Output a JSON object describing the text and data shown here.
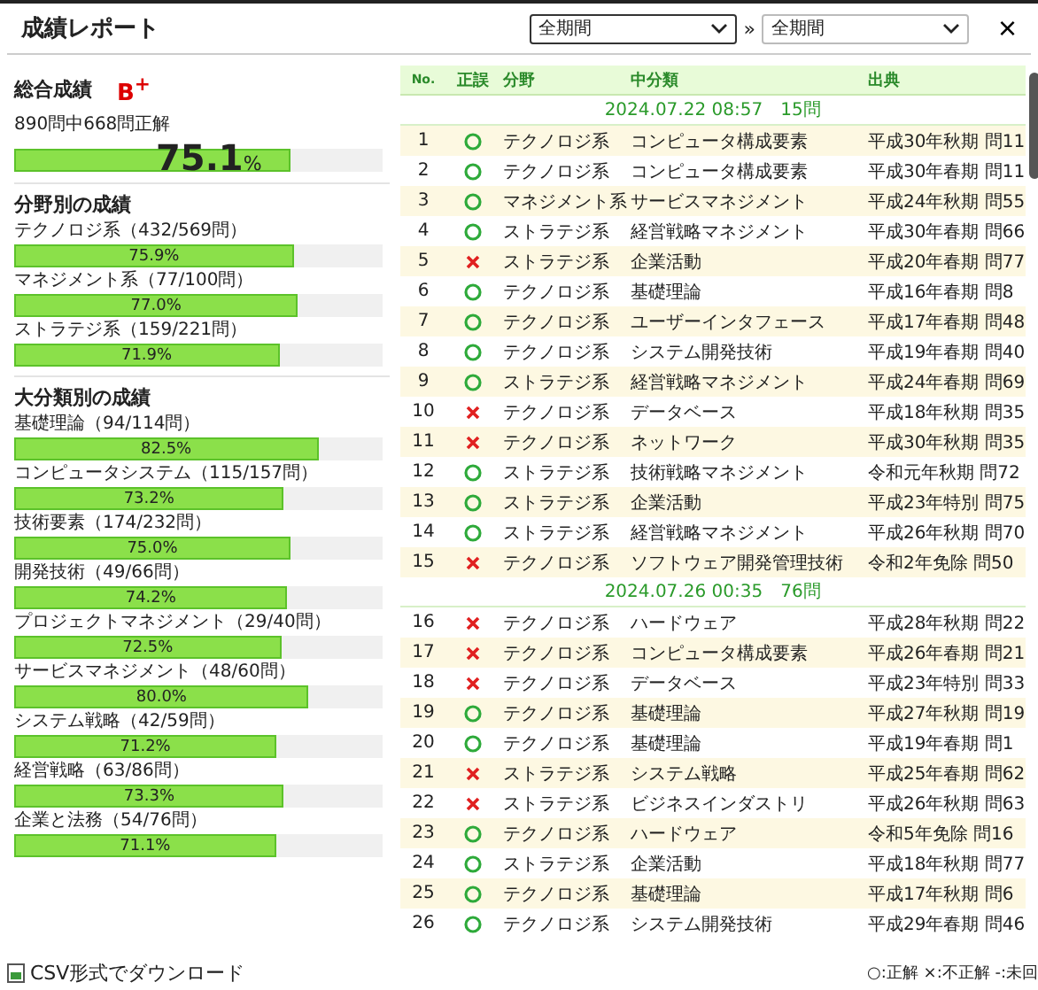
{
  "window": {
    "title": "成績レポート",
    "period_from": "全期間",
    "separator": "»",
    "period_to": "全期間",
    "close": "×"
  },
  "overall": {
    "heading": "総合成績",
    "grade": "B$^{+}$",
    "summary": "890問中668問正解",
    "percent": "75.1",
    "unit": "%",
    "level": 0.751
  },
  "sections": [
    {
      "heading": "分野別の成績",
      "items": [
        {
          "label": "テクノロジ系（432/569問）",
          "reading": "75.9%",
          "level": 0.759
        },
        {
          "label": "マネジメント系（77/100問）",
          "reading": "77.0%",
          "level": 0.77
        },
        {
          "label": "ストラテジ系（159/221問）",
          "reading": "71.9%",
          "level": 0.719
        }
      ]
    },
    {
      "heading": "大分類別の成績",
      "items": [
        {
          "label": "基礎理論（94/114問）",
          "reading": "82.5%",
          "level": 0.825
        },
        {
          "label": "コンピュータシステム（115/157問）",
          "reading": "73.2%",
          "level": 0.732
        },
        {
          "label": "技術要素（174/232問）",
          "reading": "75.0%",
          "level": 0.75
        },
        {
          "label": "開発技術（49/66問）",
          "reading": "74.2%",
          "level": 0.742
        },
        {
          "label": "プロジェクトマネジメント（29/40問）",
          "reading": "72.5%",
          "level": 0.725
        },
        {
          "label": "サービスマネジメント（48/60問）",
          "reading": "80.0%",
          "level": 0.8
        },
        {
          "label": "システム戦略（42/59問）",
          "reading": "71.2%",
          "level": 0.712
        },
        {
          "label": "経営戦略（63/86問）",
          "reading": "73.3%",
          "level": 0.733
        },
        {
          "label": "企業と法務（54/76問）",
          "reading": "71.1%",
          "level": 0.711
        }
      ]
    }
  ],
  "csv_link": "CSV形式でダウンロード",
  "table": {
    "columns": [
      "No.",
      "正誤",
      "分野",
      "中分類",
      "出典"
    ],
    "groups": [
      {
        "date": "2024.07.22 08:57",
        "count": "15問",
        "rows": [
          {
            "no": "1",
            "correct": true,
            "field": "テクノロジ系",
            "category": "コンピュータ構成要素",
            "source": "平成30年秋期 問11"
          },
          {
            "no": "2",
            "correct": true,
            "field": "テクノロジ系",
            "category": "コンピュータ構成要素",
            "source": "平成30年春期 問11"
          },
          {
            "no": "3",
            "correct": true,
            "field": "マネジメント系",
            "category": "サービスマネジメント",
            "source": "平成24年秋期 問55"
          },
          {
            "no": "4",
            "correct": true,
            "field": "ストラテジ系",
            "category": "経営戦略マネジメント",
            "source": "平成30年春期 問66"
          },
          {
            "no": "5",
            "correct": false,
            "field": "ストラテジ系",
            "category": "企業活動",
            "source": "平成20年春期 問77"
          },
          {
            "no": "6",
            "correct": true,
            "field": "テクノロジ系",
            "category": "基礎理論",
            "source": "平成16年春期 問8"
          },
          {
            "no": "7",
            "correct": true,
            "field": "テクノロジ系",
            "category": "ユーザーインタフェース",
            "source": "平成17年春期 問48"
          },
          {
            "no": "8",
            "correct": true,
            "field": "テクノロジ系",
            "category": "システム開発技術",
            "source": "平成19年春期 問40"
          },
          {
            "no": "9",
            "correct": true,
            "field": "ストラテジ系",
            "category": "経営戦略マネジメント",
            "source": "平成24年春期 問69"
          },
          {
            "no": "10",
            "correct": false,
            "field": "テクノロジ系",
            "category": "データベース",
            "source": "平成18年秋期 問35"
          },
          {
            "no": "11",
            "correct": false,
            "field": "テクノロジ系",
            "category": "ネットワーク",
            "source": "平成30年秋期 問35"
          },
          {
            "no": "12",
            "correct": true,
            "field": "ストラテジ系",
            "category": "技術戦略マネジメント",
            "source": "令和元年秋期 問72"
          },
          {
            "no": "13",
            "correct": true,
            "field": "ストラテジ系",
            "category": "企業活動",
            "source": "平成23年特別 問75"
          },
          {
            "no": "14",
            "correct": true,
            "field": "ストラテジ系",
            "category": "経営戦略マネジメント",
            "source": "平成26年秋期 問70"
          },
          {
            "no": "15",
            "correct": false,
            "field": "テクノロジ系",
            "category": "ソフトウェア開発管理技術",
            "source": "令和2年免除 問50"
          }
        ]
      },
      {
        "date": "2024.07.26 00:35",
        "count": "76問",
        "rows": [
          {
            "no": "16",
            "correct": false,
            "field": "テクノロジ系",
            "category": "ハードウェア",
            "source": "平成28年秋期 問22"
          },
          {
            "no": "17",
            "correct": false,
            "field": "テクノロジ系",
            "category": "コンピュータ構成要素",
            "source": "平成26年春期 問21"
          },
          {
            "no": "18",
            "correct": false,
            "field": "テクノロジ系",
            "category": "データベース",
            "source": "平成23年特別 問33"
          },
          {
            "no": "19",
            "correct": true,
            "field": "テクノロジ系",
            "category": "基礎理論",
            "source": "平成27年秋期 問19"
          },
          {
            "no": "20",
            "correct": true,
            "field": "テクノロジ系",
            "category": "基礎理論",
            "source": "平成19年春期 問1"
          },
          {
            "no": "21",
            "correct": false,
            "field": "ストラテジ系",
            "category": "システム戦略",
            "source": "平成25年春期 問62"
          },
          {
            "no": "22",
            "correct": false,
            "field": "ストラテジ系",
            "category": "ビジネスインダストリ",
            "source": "平成26年秋期 問63"
          },
          {
            "no": "23",
            "correct": true,
            "field": "テクノロジ系",
            "category": "ハードウェア",
            "source": "令和5年免除 問16"
          },
          {
            "no": "24",
            "correct": true,
            "field": "ストラテジ系",
            "category": "企業活動",
            "source": "平成18年秋期 問77"
          },
          {
            "no": "25",
            "correct": true,
            "field": "テクノロジ系",
            "category": "基礎理論",
            "source": "平成17年秋期 問6"
          },
          {
            "no": "26",
            "correct": true,
            "field": "テクノロジ系",
            "category": "システム開発技術",
            "source": "平成29年春期 問46"
          }
        ]
      }
    ]
  },
  "legend": "○:正解 ×:不正解 -:未回"
}
